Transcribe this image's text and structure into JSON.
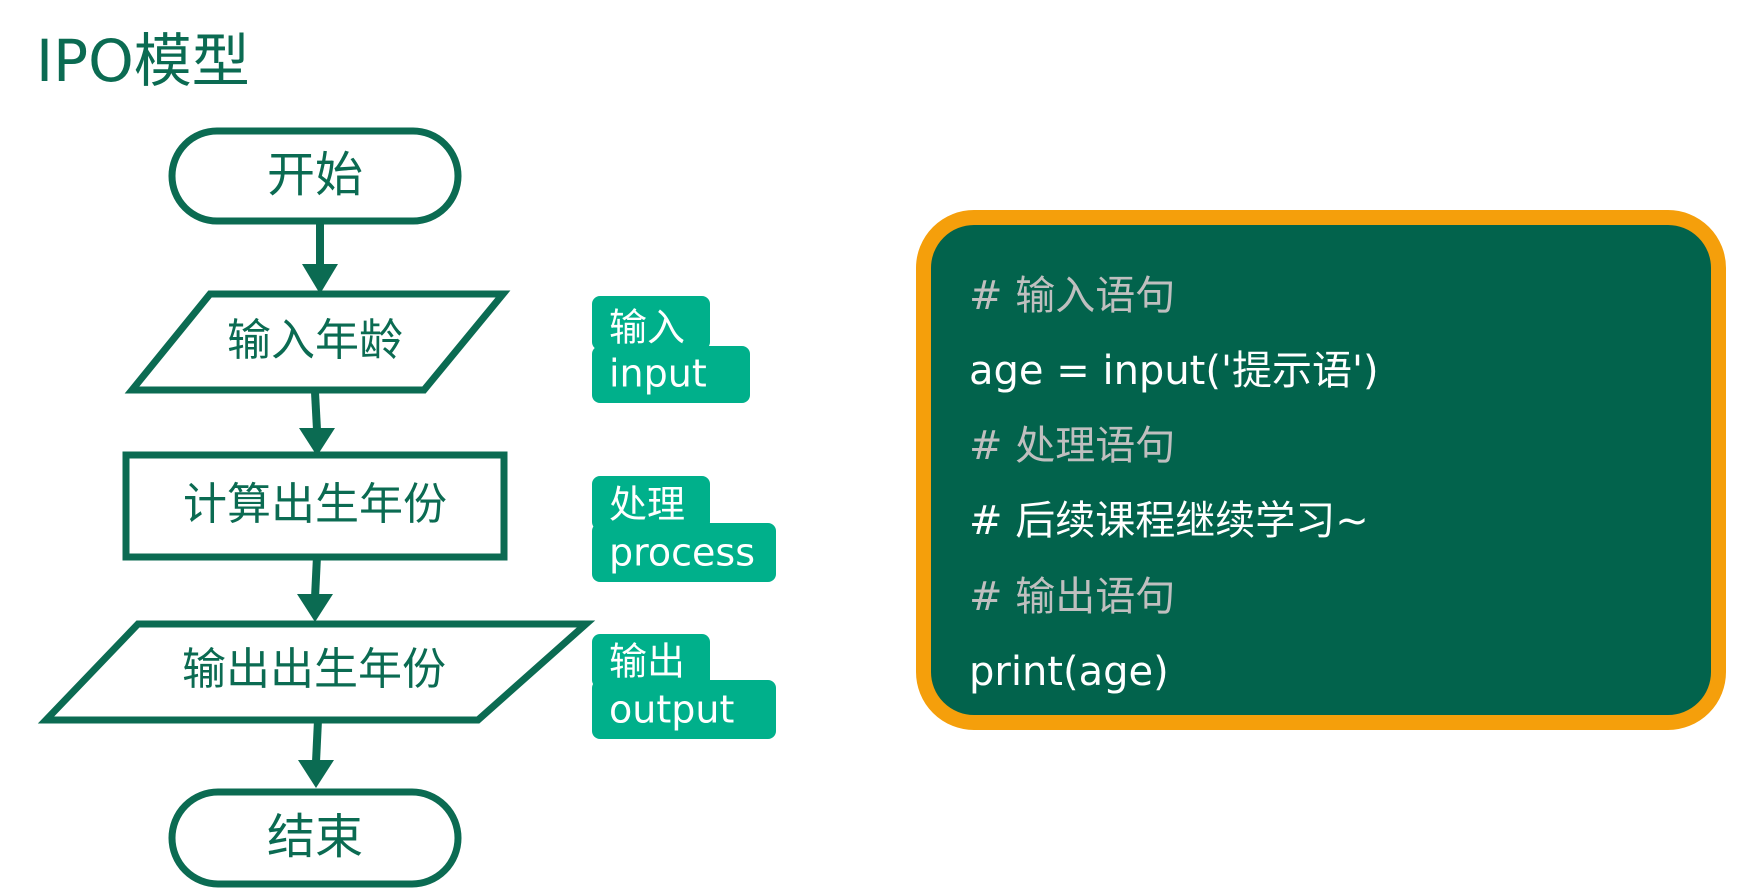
{
  "title": "IPO模型",
  "flowchart": {
    "start": "开始",
    "input_step": "输入年龄",
    "process_step": "计算出生年份",
    "output_step": "输出出生年份",
    "end": "结束"
  },
  "tags": [
    {
      "cn": "输入",
      "en": "input"
    },
    {
      "cn": "处理",
      "en": "process"
    },
    {
      "cn": "输出",
      "en": "output"
    }
  ],
  "code": {
    "lines": [
      {
        "text": "# 输入语句",
        "kind": "comment"
      },
      {
        "text": "age = input('提示语')",
        "kind": "code"
      },
      {
        "text": "# 处理语句",
        "kind": "comment"
      },
      {
        "text": "# 后续课程继续学习~",
        "kind": "code"
      },
      {
        "text": "# 输出语句",
        "kind": "comment"
      },
      {
        "text": "print(age)",
        "kind": "code"
      }
    ]
  },
  "colors": {
    "dark_green": "#0b6b52",
    "tag_green": "#00b08b",
    "code_bg": "#02634c",
    "code_border": "#f59f0b",
    "comment_gray": "#bfbfbf"
  }
}
